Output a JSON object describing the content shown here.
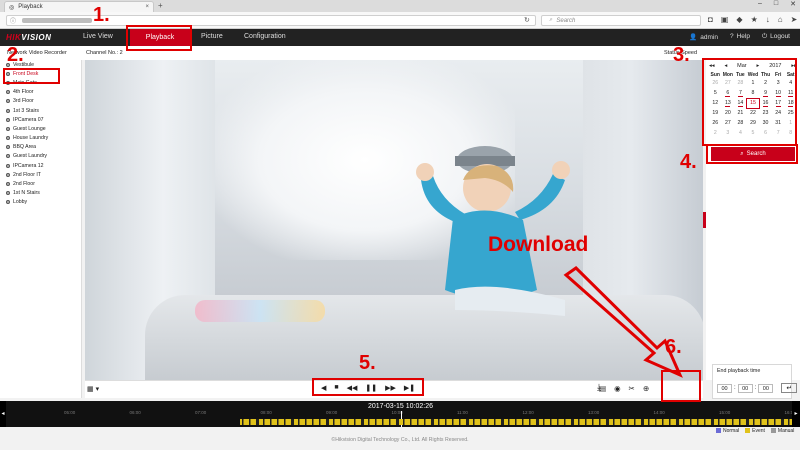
{
  "browser": {
    "tab_title": "Playback",
    "search_placeholder": "Search",
    "tab_close": "×",
    "new_tab": "+"
  },
  "app": {
    "logo_prefix": "HIK",
    "logo_suffix": "VISION",
    "nav": [
      "Live View",
      "Playback",
      "Picture",
      "Configuration"
    ],
    "user": "admin",
    "help": "Help",
    "logout": "Logout"
  },
  "subheader": {
    "device": "Network Video Recorder",
    "channel": "Channel No.: 2",
    "speed": "Status Speed"
  },
  "cameras": [
    {
      "label": "Vestibule"
    },
    {
      "label": "Front Desk",
      "selected": true
    },
    {
      "label": "Main Gate"
    },
    {
      "label": "4th Floor"
    },
    {
      "label": "3rd Floor"
    },
    {
      "label": "1st 3 Stairs"
    },
    {
      "label": "IPCamera 07"
    },
    {
      "label": "Guest Lounge"
    },
    {
      "label": "House Laundry"
    },
    {
      "label": "BBQ Area"
    },
    {
      "label": "Guest Laundry"
    },
    {
      "label": "IPCamera 12"
    },
    {
      "label": "2nd Floor IT"
    },
    {
      "label": "2nd Floor"
    },
    {
      "label": "1st N Stairs"
    },
    {
      "label": "Lobby"
    }
  ],
  "calendar": {
    "month": "Mar",
    "year": "2017",
    "day_headers": [
      "Sun",
      "Mon",
      "Tue",
      "Wed",
      "Thu",
      "Fri",
      "Sat"
    ],
    "days": [
      {
        "d": "26",
        "o": true
      },
      {
        "d": "27",
        "o": true
      },
      {
        "d": "28",
        "o": true
      },
      {
        "d": "1"
      },
      {
        "d": "2"
      },
      {
        "d": "3"
      },
      {
        "d": "4"
      },
      {
        "d": "5"
      },
      {
        "d": "6",
        "r": true
      },
      {
        "d": "7",
        "r": true
      },
      {
        "d": "8"
      },
      {
        "d": "9",
        "r": true
      },
      {
        "d": "10",
        "r": true
      },
      {
        "d": "11",
        "r": true
      },
      {
        "d": "12"
      },
      {
        "d": "13",
        "r": true
      },
      {
        "d": "14",
        "r": true
      },
      {
        "d": "15",
        "today": true
      },
      {
        "d": "16",
        "r": true
      },
      {
        "d": "17",
        "r": true
      },
      {
        "d": "18",
        "r": true
      },
      {
        "d": "19"
      },
      {
        "d": "20"
      },
      {
        "d": "21"
      },
      {
        "d": "22"
      },
      {
        "d": "23"
      },
      {
        "d": "24"
      },
      {
        "d": "25"
      },
      {
        "d": "26"
      },
      {
        "d": "27"
      },
      {
        "d": "28"
      },
      {
        "d": "29"
      },
      {
        "d": "30"
      },
      {
        "d": "31"
      },
      {
        "d": "1",
        "o": true
      },
      {
        "d": "2",
        "o": true
      },
      {
        "d": "3",
        "o": true
      },
      {
        "d": "4",
        "o": true
      },
      {
        "d": "5",
        "o": true
      },
      {
        "d": "6",
        "o": true
      },
      {
        "d": "7",
        "o": true
      },
      {
        "d": "8",
        "o": true
      }
    ],
    "search_label": "Search"
  },
  "end_playback": {
    "label": "End playback time",
    "hh": "00",
    "mm": "00",
    "ss": "00"
  },
  "timeline": {
    "current": "2017-03-15 10:02:26",
    "ticks": [
      "05:00",
      "06:00",
      "07:00",
      "08:00",
      "09:00",
      "10:00",
      "11:00",
      "12:00",
      "13:00",
      "14:00",
      "15:00",
      "16:00"
    ],
    "legend": [
      {
        "label": "Normal",
        "color": "#6b6bd6"
      },
      {
        "label": "Event",
        "color": "#e0c21a"
      },
      {
        "label": "Manual",
        "color": "#999999"
      }
    ]
  },
  "annotations": {
    "n1": "1.",
    "n2": "2.",
    "n3": "3.",
    "n4": "4.",
    "n5": "5.",
    "n6": "6.",
    "download": "Download"
  },
  "copyright": "©Hikvision Digital Technology Co., Ltd. All Rights Reserved.",
  "colors": {
    "accent": "#c8001a",
    "annotation": "#e00000"
  }
}
